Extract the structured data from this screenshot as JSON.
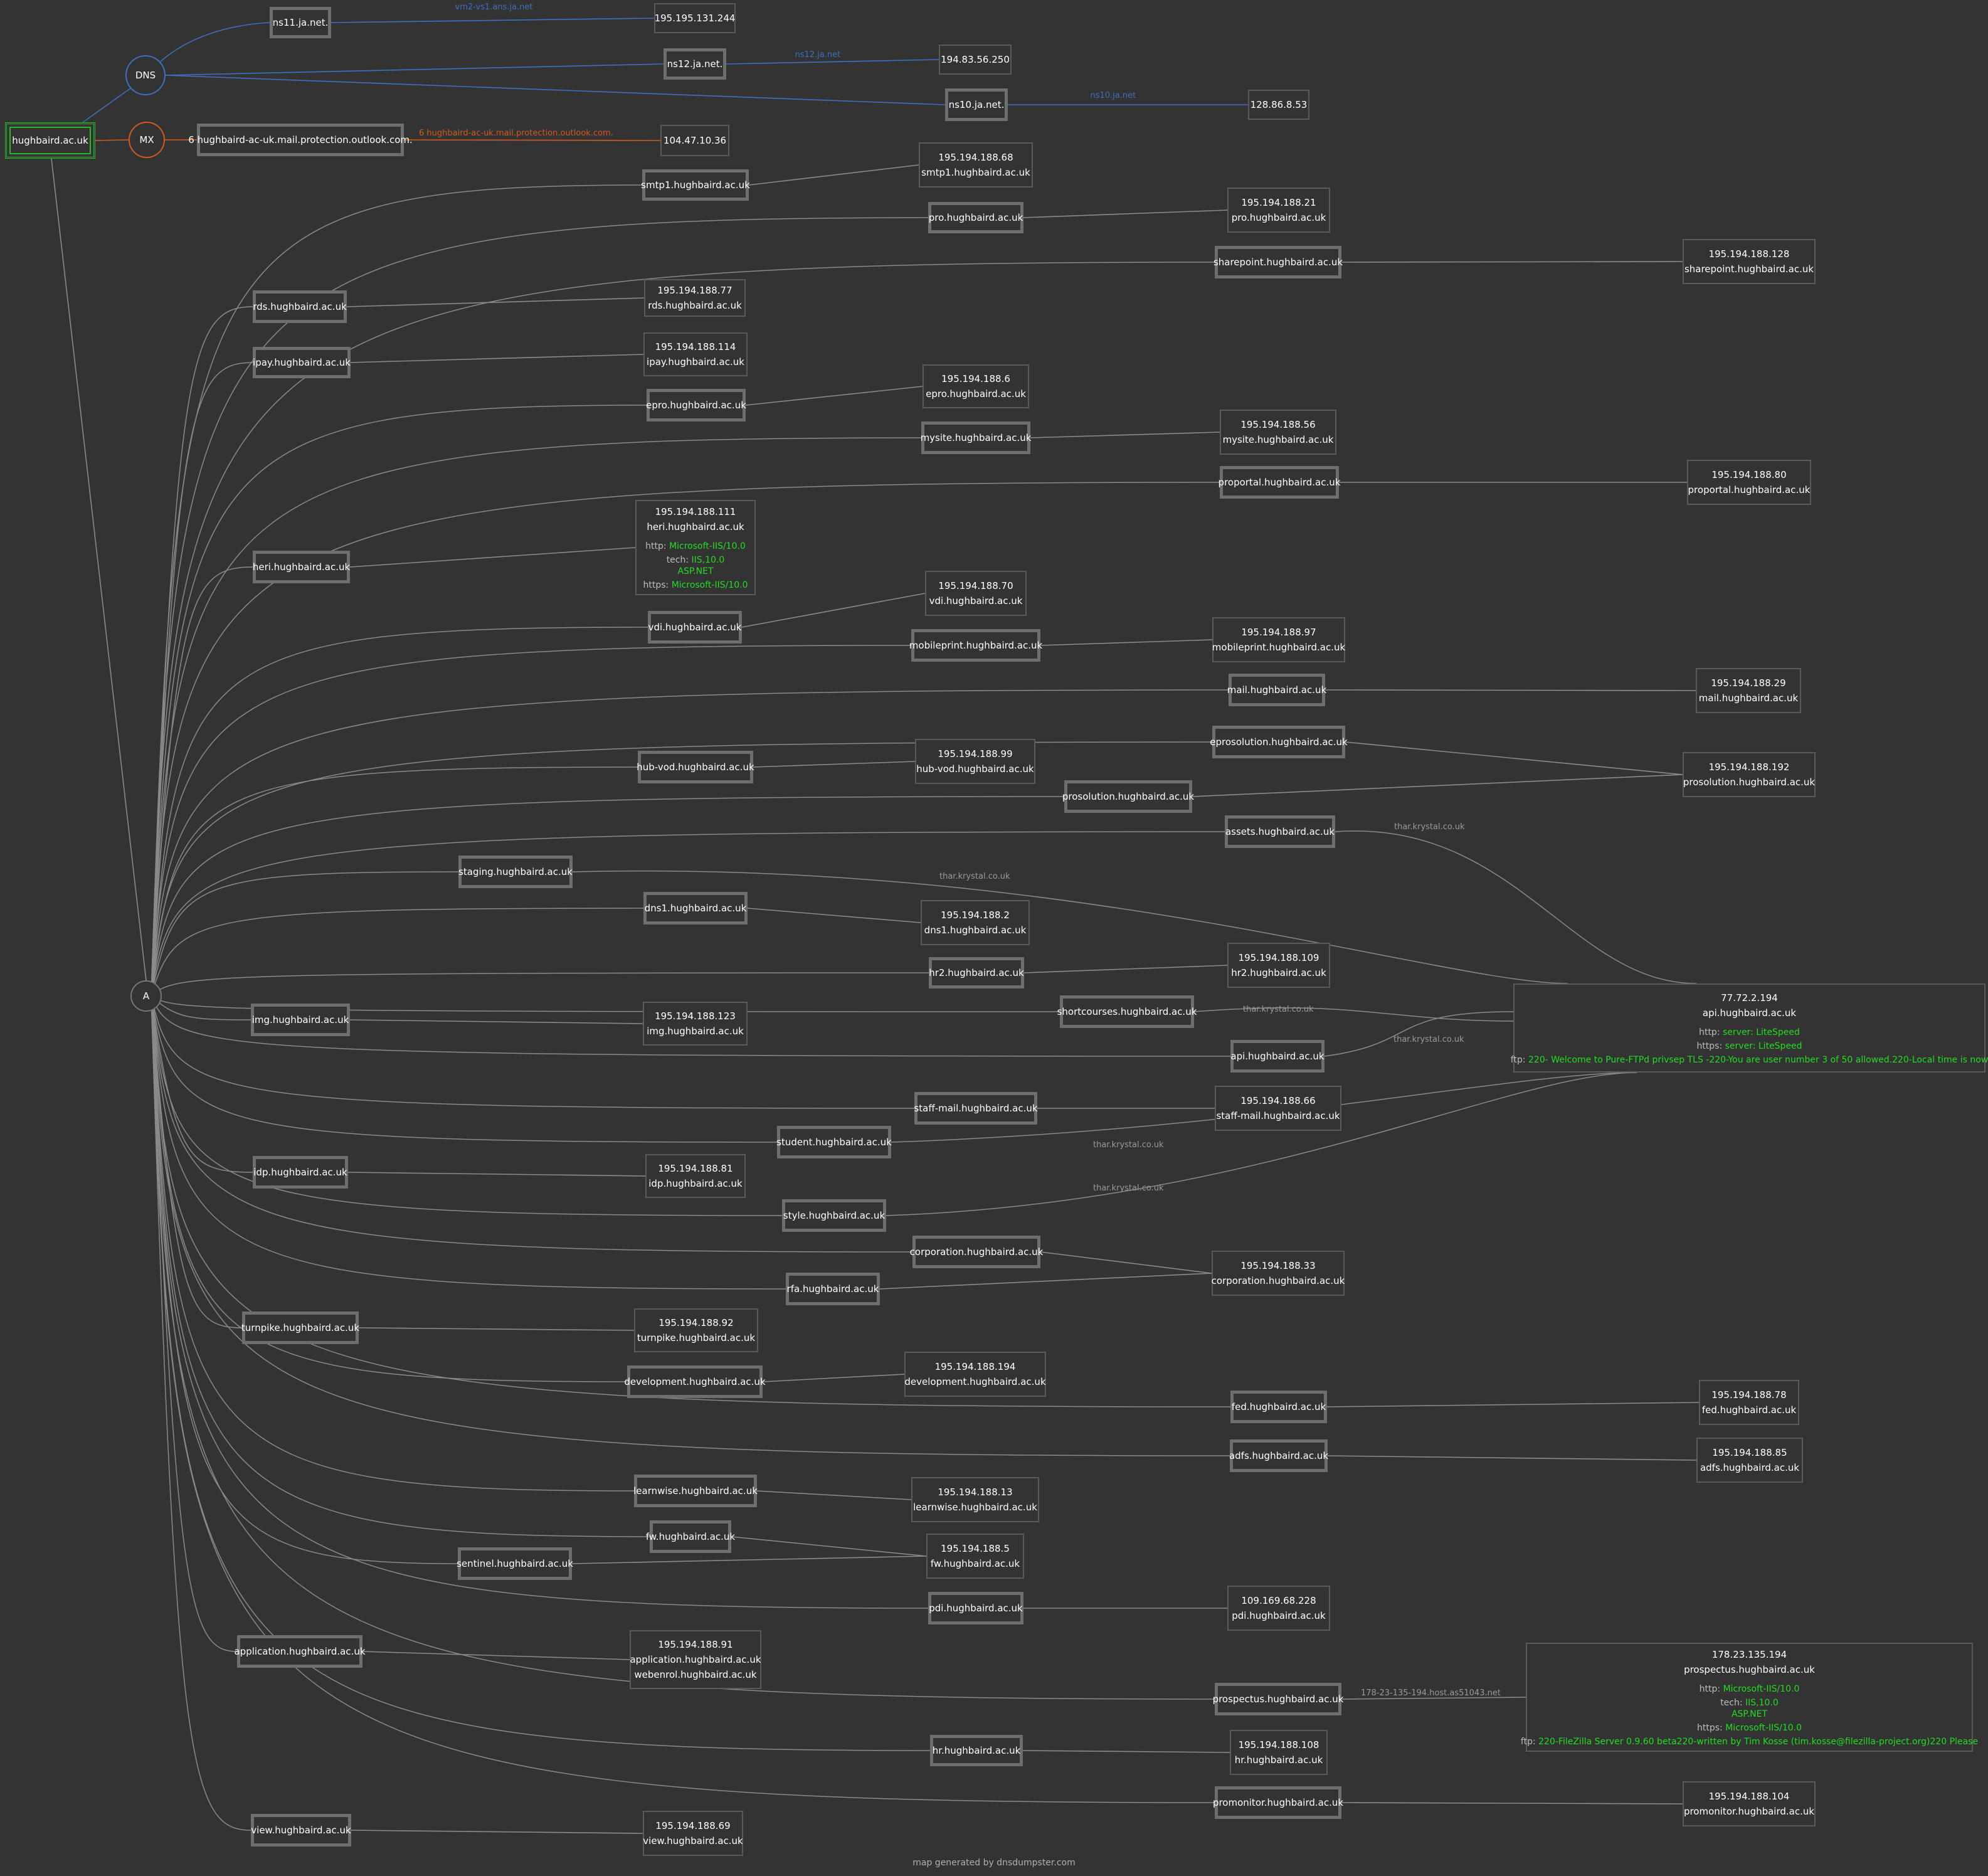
{
  "root": {
    "id": "root",
    "label": "hughbaird.ac.uk"
  },
  "groups": {
    "dns": "DNS",
    "mx": "MX",
    "a": "A"
  },
  "ns": [
    {
      "id": "ns11",
      "name": "ns11.ja.net.",
      "ip": "195.195.131.244",
      "link": "vm2-vs1.ans.ja.net"
    },
    {
      "id": "ns12",
      "name": "ns12.ja.net.",
      "ip": "194.83.56.250",
      "link": "ns12.ja.net"
    },
    {
      "id": "ns10",
      "name": "ns10.ja.net.",
      "ip": "128.86.8.53",
      "link": "ns10.ja.net"
    }
  ],
  "mx": {
    "name": "6 hughbaird-ac-uk.mail.protection.outlook.com.",
    "ip": "104.47.10.36",
    "link": "6 hughbaird-ac-uk.mail.protection.outlook.com."
  },
  "hosts": [
    {
      "id": "h0",
      "name": "smtp1.hughbaird.ac.uk",
      "target": "t0"
    },
    {
      "id": "h1",
      "name": "pro.hughbaird.ac.uk",
      "target": "t1"
    },
    {
      "id": "h2",
      "name": "sharepoint.hughbaird.ac.uk",
      "target": "t2"
    },
    {
      "id": "h3",
      "name": "rds.hughbaird.ac.uk",
      "target": "t3"
    },
    {
      "id": "h4",
      "name": "ipay.hughbaird.ac.uk",
      "target": "t4"
    },
    {
      "id": "h5",
      "name": "epro.hughbaird.ac.uk",
      "target": "t5"
    },
    {
      "id": "h6",
      "name": "mysite.hughbaird.ac.uk",
      "target": "t6"
    },
    {
      "id": "h7",
      "name": "proportal.hughbaird.ac.uk",
      "target": "t7"
    },
    {
      "id": "h8",
      "name": "heri.hughbaird.ac.uk",
      "target": "t8"
    },
    {
      "id": "h9",
      "name": "vdi.hughbaird.ac.uk",
      "target": "t9"
    },
    {
      "id": "h10",
      "name": "mobileprint.hughbaird.ac.uk",
      "target": "t10"
    },
    {
      "id": "h11",
      "name": "mail.hughbaird.ac.uk",
      "target": "t11"
    },
    {
      "id": "h12",
      "name": "eprosolution.hughbaird.ac.uk",
      "target": "t12"
    },
    {
      "id": "h13",
      "name": "hub-vod.hughbaird.ac.uk",
      "target": "t13"
    },
    {
      "id": "h14",
      "name": "prosolution.hughbaird.ac.uk",
      "target": "t12"
    },
    {
      "id": "h15",
      "name": "assets.hughbaird.ac.uk",
      "target": "tapi",
      "via": "thar.krystal.co.uk"
    },
    {
      "id": "h16",
      "name": "staging.hughbaird.ac.uk",
      "target": "tapi",
      "via": "thar.krystal.co.uk"
    },
    {
      "id": "h17",
      "name": "dns1.hughbaird.ac.uk",
      "target": "t14"
    },
    {
      "id": "h18",
      "name": "hr2.hughbaird.ac.uk",
      "target": "t15"
    },
    {
      "id": "h19",
      "name": "shortcourses.hughbaird.ac.uk",
      "target": "tapi",
      "via": "thar.krystal.co.uk"
    },
    {
      "id": "h20",
      "name": "img.hughbaird.ac.uk",
      "target": "t16"
    },
    {
      "id": "h21",
      "name": "api.hughbaird.ac.uk",
      "target": "tapi",
      "via": "thar.krystal.co.uk"
    },
    {
      "id": "h22",
      "name": "staff-mail.hughbaird.ac.uk",
      "target": "t17"
    },
    {
      "id": "h23",
      "name": "student.hughbaird.ac.uk",
      "target": "tapi",
      "via": "thar.krystal.co.uk"
    },
    {
      "id": "h24",
      "name": "idp.hughbaird.ac.uk",
      "target": "t18"
    },
    {
      "id": "h25",
      "name": "style.hughbaird.ac.uk",
      "target": "tapi",
      "via": "thar.krystal.co.uk"
    },
    {
      "id": "h26",
      "name": "corporation.hughbaird.ac.uk",
      "target": "t19"
    },
    {
      "id": "h27",
      "name": "rfa.hughbaird.ac.uk",
      "target": "t19"
    },
    {
      "id": "h28",
      "name": "turnpike.hughbaird.ac.uk",
      "target": "t20"
    },
    {
      "id": "h29",
      "name": "development.hughbaird.ac.uk",
      "target": "t21"
    },
    {
      "id": "h30",
      "name": "fed.hughbaird.ac.uk",
      "target": "t22"
    },
    {
      "id": "h31",
      "name": "adfs.hughbaird.ac.uk",
      "target": "t23"
    },
    {
      "id": "h32",
      "name": "learnwise.hughbaird.ac.uk",
      "target": "t24"
    },
    {
      "id": "h33",
      "name": "fw.hughbaird.ac.uk",
      "target": "t25"
    },
    {
      "id": "h34",
      "name": "sentinel.hughbaird.ac.uk",
      "target": "t25"
    },
    {
      "id": "h35",
      "name": "pdi.hughbaird.ac.uk",
      "target": "t26"
    },
    {
      "id": "h36",
      "name": "application.hughbaird.ac.uk",
      "target": "t27"
    },
    {
      "id": "h37",
      "name": "prospectus.hughbaird.ac.uk",
      "target": "tpros",
      "via": "178-23-135-194.host.as51043.net"
    },
    {
      "id": "h38",
      "name": "hr.hughbaird.ac.uk",
      "target": "t28"
    },
    {
      "id": "h39",
      "name": "promonitor.hughbaird.ac.uk",
      "target": "t29"
    },
    {
      "id": "h40",
      "name": "view.hughbaird.ac.uk",
      "target": "t30"
    }
  ],
  "targets": [
    {
      "id": "t0",
      "lines": [
        "195.194.188.68",
        "smtp1.hughbaird.ac.uk"
      ]
    },
    {
      "id": "t1",
      "lines": [
        "195.194.188.21",
        "pro.hughbaird.ac.uk"
      ]
    },
    {
      "id": "t2",
      "lines": [
        "195.194.188.128",
        "sharepoint.hughbaird.ac.uk"
      ]
    },
    {
      "id": "t3",
      "lines": [
        "195.194.188.77",
        "rds.hughbaird.ac.uk"
      ]
    },
    {
      "id": "t4",
      "lines": [
        "195.194.188.114",
        "ipay.hughbaird.ac.uk"
      ]
    },
    {
      "id": "t5",
      "lines": [
        "195.194.188.6",
        "epro.hughbaird.ac.uk"
      ]
    },
    {
      "id": "t6",
      "lines": [
        "195.194.188.56",
        "mysite.hughbaird.ac.uk"
      ]
    },
    {
      "id": "t7",
      "lines": [
        "195.194.188.80",
        "proportal.hughbaird.ac.uk"
      ]
    },
    {
      "id": "t8",
      "lines": [
        "195.194.188.111",
        "heri.hughbaird.ac.uk"
      ],
      "services": [
        {
          "key": "http:",
          "value": "Microsoft-IIS/10.0"
        },
        {
          "key": "tech:",
          "value": "IIS,10.0"
        },
        {
          "key": "",
          "value": "ASP.NET"
        },
        {
          "key": "https:",
          "value": "Microsoft-IIS/10.0"
        }
      ]
    },
    {
      "id": "t9",
      "lines": [
        "195.194.188.70",
        "vdi.hughbaird.ac.uk"
      ]
    },
    {
      "id": "t10",
      "lines": [
        "195.194.188.97",
        "mobileprint.hughbaird.ac.uk"
      ]
    },
    {
      "id": "t11",
      "lines": [
        "195.194.188.29",
        "mail.hughbaird.ac.uk"
      ]
    },
    {
      "id": "t12",
      "lines": [
        "195.194.188.192",
        "prosolution.hughbaird.ac.uk"
      ]
    },
    {
      "id": "t13",
      "lines": [
        "195.194.188.99",
        "hub-vod.hughbaird.ac.uk"
      ]
    },
    {
      "id": "t14",
      "lines": [
        "195.194.188.2",
        "dns1.hughbaird.ac.uk"
      ]
    },
    {
      "id": "t15",
      "lines": [
        "195.194.188.109",
        "hr2.hughbaird.ac.uk"
      ]
    },
    {
      "id": "t16",
      "lines": [
        "195.194.188.123",
        "img.hughbaird.ac.uk"
      ]
    },
    {
      "id": "tapi",
      "lines": [
        "77.72.2.194",
        "api.hughbaird.ac.uk"
      ],
      "services": [
        {
          "key": "http:",
          "value": "server: LiteSpeed"
        },
        {
          "key": "https:",
          "value": "server: LiteSpeed"
        },
        {
          "key": "ftp:",
          "value": "220- Welcome to Pure-FTPd privsep TLS -220-You are user number 3 of 50 allowed.220-Local time is now"
        }
      ]
    },
    {
      "id": "t17",
      "lines": [
        "195.194.188.66",
        "staff-mail.hughbaird.ac.uk"
      ]
    },
    {
      "id": "t18",
      "lines": [
        "195.194.188.81",
        "idp.hughbaird.ac.uk"
      ]
    },
    {
      "id": "t19",
      "lines": [
        "195.194.188.33",
        "corporation.hughbaird.ac.uk"
      ]
    },
    {
      "id": "t20",
      "lines": [
        "195.194.188.92",
        "turnpike.hughbaird.ac.uk"
      ]
    },
    {
      "id": "t21",
      "lines": [
        "195.194.188.194",
        "development.hughbaird.ac.uk"
      ]
    },
    {
      "id": "t22",
      "lines": [
        "195.194.188.78",
        "fed.hughbaird.ac.uk"
      ]
    },
    {
      "id": "t23",
      "lines": [
        "195.194.188.85",
        "adfs.hughbaird.ac.uk"
      ]
    },
    {
      "id": "t24",
      "lines": [
        "195.194.188.13",
        "learnwise.hughbaird.ac.uk"
      ]
    },
    {
      "id": "t25",
      "lines": [
        "195.194.188.5",
        "fw.hughbaird.ac.uk"
      ]
    },
    {
      "id": "t26",
      "lines": [
        "109.169.68.228",
        "pdi.hughbaird.ac.uk"
      ]
    },
    {
      "id": "t27",
      "lines": [
        "195.194.188.91",
        "application.hughbaird.ac.uk",
        "webenrol.hughbaird.ac.uk"
      ]
    },
    {
      "id": "tpros",
      "lines": [
        "178.23.135.194",
        "prospectus.hughbaird.ac.uk"
      ],
      "services": [
        {
          "key": "http:",
          "value": "Microsoft-IIS/10.0"
        },
        {
          "key": "tech:",
          "value": "IIS,10.0"
        },
        {
          "key": "",
          "value": "ASP.NET"
        },
        {
          "key": "https:",
          "value": "Microsoft-IIS/10.0"
        },
        {
          "key": "ftp:",
          "value": "220-FileZilla Server 0.9.60 beta220-written by Tim Kosse (tim.kosse@filezilla-project.org)220 Please"
        }
      ]
    },
    {
      "id": "t28",
      "lines": [
        "195.194.188.108",
        "hr.hughbaird.ac.uk"
      ]
    },
    {
      "id": "t29",
      "lines": [
        "195.194.188.104",
        "promonitor.hughbaird.ac.uk"
      ]
    },
    {
      "id": "t30",
      "lines": [
        "195.194.188.69",
        "view.hughbaird.ac.uk"
      ]
    }
  ],
  "footer": "map generated by dnsdumpster.com",
  "colors": {
    "background": "#333333",
    "edge": "#8a8a8a",
    "dns": "#3f6fc0",
    "mx": "#d25a21",
    "root": "#2bb52b",
    "service": "#22dd22",
    "nodeBorder": "#6e6e6e"
  }
}
